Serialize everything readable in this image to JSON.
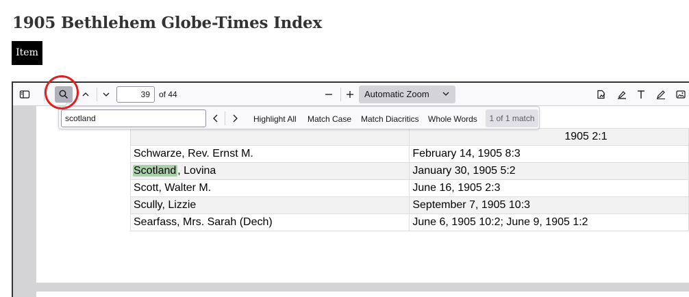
{
  "header": {
    "title": "1905 Bethlehem Globe-Times Index",
    "item_tag": "Item"
  },
  "toolbar": {
    "page_number": "39",
    "page_count_label": "of 44",
    "zoom_label": "Automatic Zoom",
    "icons": [
      "sidebar-toggle-icon",
      "search-icon",
      "chevron-up-icon",
      "chevron-down-icon",
      "zoom-out-icon",
      "zoom-in-icon",
      "chevron-down-icon",
      "stamp-icon",
      "highlight-icon",
      "text-icon",
      "draw-icon",
      "image-icon"
    ]
  },
  "findbar": {
    "query": "scotland",
    "highlight_all": "Highlight All",
    "match_case": "Match Case",
    "match_diacritics": "Match Diacritics",
    "whole_words": "Whole Words",
    "match_count": "1 of 1 match"
  },
  "table": {
    "rows": [
      {
        "name": "",
        "date": "1905 2:1"
      },
      {
        "name": "Schwarze, Rev. Ernst M.",
        "date": "February 14, 1905 8:3"
      },
      {
        "name_highlight": "Scotland",
        "name_rest": ", Lovina",
        "date": "January 30, 1905 5:2"
      },
      {
        "name": "Scott, Walter M.",
        "date": "June 16, 1905 2:3"
      },
      {
        "name": "Scully, Lizzie",
        "date": "September 7, 1905 10:3"
      },
      {
        "name": "Searfass, Mrs. Sarah (Dech)",
        "date": "June 6, 1905 10:2; June 9, 1905 1:2"
      }
    ]
  },
  "colors": {
    "annotation_circle": "#e02020",
    "match_highlight": "#a9d1a9",
    "active_button": "#b1b1b9"
  }
}
